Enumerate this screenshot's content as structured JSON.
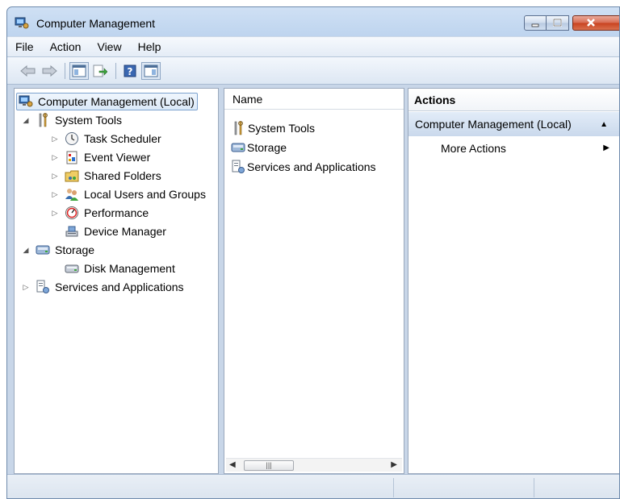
{
  "window": {
    "title": "Computer Management"
  },
  "menu": [
    "File",
    "Action",
    "View",
    "Help"
  ],
  "toolbar": {
    "buttons": [
      "back-arrow-icon",
      "forward-arrow-icon",
      "show-hide-console-tree-icon",
      "export-list-icon",
      "help-icon",
      "show-hide-action-pane-icon"
    ]
  },
  "tree": {
    "root": "Computer Management (Local)",
    "system_tools": "System Tools",
    "task_scheduler": "Task Scheduler",
    "event_viewer": "Event Viewer",
    "shared_folders": "Shared Folders",
    "local_users": "Local Users and Groups",
    "performance": "Performance",
    "device_manager": "Device Manager",
    "storage": "Storage",
    "disk_management": "Disk Management",
    "services": "Services and Applications"
  },
  "list": {
    "header": "Name",
    "items": [
      "System Tools",
      "Storage",
      "Services and Applications"
    ]
  },
  "actions": {
    "header": "Actions",
    "section": "Computer Management (Local)",
    "more": "More Actions"
  },
  "colors": {
    "accent": "#7da2ce",
    "titlebar": "#bcd3ee",
    "close": "#c8421f"
  }
}
